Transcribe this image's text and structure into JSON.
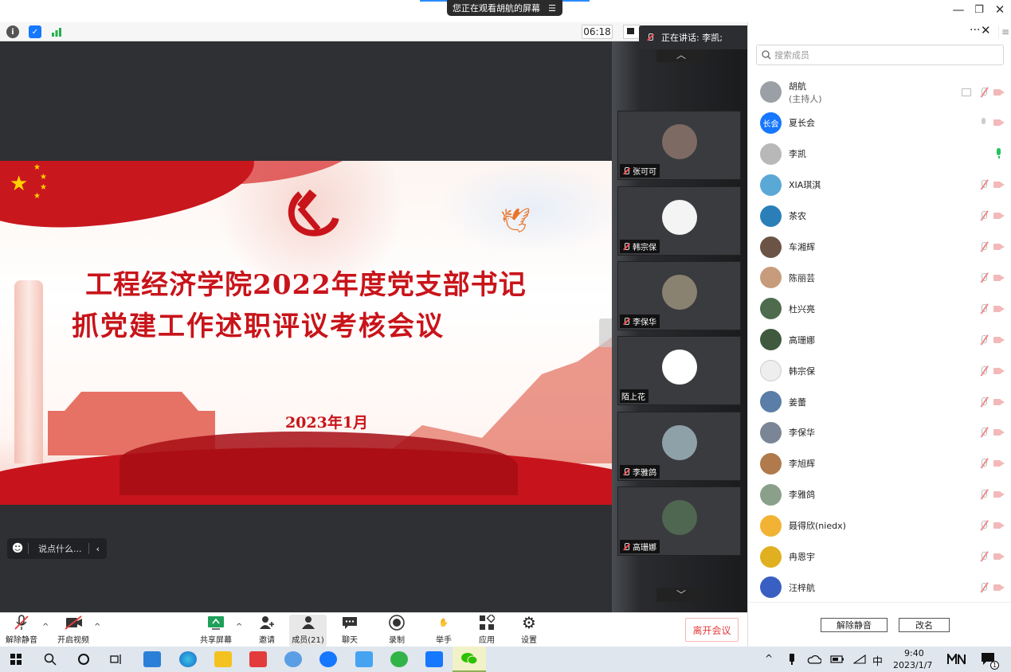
{
  "window": {
    "banner": "您正在观看胡航的屏幕",
    "banner_menu": "☰",
    "minimize": "—",
    "restore": "❐",
    "close": "✕"
  },
  "infobar": {
    "timer": "06:18"
  },
  "speaking": {
    "label": "正在讲话: 李凯;"
  },
  "slide": {
    "title_line1": "工程经济学院2022年度党支部书记",
    "title_line2": "抓党建工作述职评议考核会议",
    "date": "2023年1月"
  },
  "chat": {
    "placeholder": "说点什么..."
  },
  "tiles": [
    {
      "name": "张可可",
      "muted": true,
      "color": "#7d6b63"
    },
    {
      "name": "韩宗保",
      "muted": true,
      "color": "#f4f4f4"
    },
    {
      "name": "李保华",
      "muted": true,
      "color": "#8a8270"
    },
    {
      "name": "陌上花",
      "muted": false,
      "color": "#ffffff"
    },
    {
      "name": "李雅鸽",
      "muted": true,
      "color": "#8fa1a8"
    },
    {
      "name": "高珊娜",
      "muted": true,
      "color": "#4f6650"
    }
  ],
  "panel": {
    "more": "···",
    "close": "✕",
    "list_icon": "≡",
    "search_placeholder": "搜索成员",
    "members": [
      {
        "name": "胡航",
        "role": "(主持人)",
        "avatar_color": "#9aa0a6",
        "avatar_text": "",
        "state": "host"
      },
      {
        "name": "夏长会",
        "role": "",
        "avatar_color": "#1677ff",
        "avatar_text": "长会",
        "state": "mic-on"
      },
      {
        "name": "李凯",
        "role": "",
        "avatar_color": "#b8b8b8",
        "avatar_text": "",
        "state": "speaking"
      },
      {
        "name": "XIA琪淇",
        "role": "",
        "avatar_color": "#5aa8d6",
        "avatar_text": "",
        "state": "muted"
      },
      {
        "name": "茶农",
        "role": "",
        "avatar_color": "#2b7fb8",
        "avatar_text": "",
        "state": "muted"
      },
      {
        "name": "车湘辉",
        "role": "",
        "avatar_color": "#6b5446",
        "avatar_text": "",
        "state": "muted"
      },
      {
        "name": "陈丽芸",
        "role": "",
        "avatar_color": "#c79c7c",
        "avatar_text": "",
        "state": "muted"
      },
      {
        "name": "杜兴亮",
        "role": "",
        "avatar_color": "#4e6b4e",
        "avatar_text": "",
        "state": "muted"
      },
      {
        "name": "高珊娜",
        "role": "",
        "avatar_color": "#3f5a3f",
        "avatar_text": "",
        "state": "muted"
      },
      {
        "name": "韩宗保",
        "role": "",
        "avatar_color": "#eeeeee",
        "avatar_text": "",
        "state": "muted"
      },
      {
        "name": "姜蕾",
        "role": "",
        "avatar_color": "#5b7ea8",
        "avatar_text": "",
        "state": "muted"
      },
      {
        "name": "李保华",
        "role": "",
        "avatar_color": "#7a8596",
        "avatar_text": "",
        "state": "muted"
      },
      {
        "name": "李旭辉",
        "role": "",
        "avatar_color": "#b07a4c",
        "avatar_text": "",
        "state": "muted"
      },
      {
        "name": "李雅鸽",
        "role": "",
        "avatar_color": "#8aa08a",
        "avatar_text": "",
        "state": "muted"
      },
      {
        "name": "聂得欣(niedx)",
        "role": "",
        "avatar_color": "#f2b233",
        "avatar_text": "",
        "state": "muted"
      },
      {
        "name": "冉恩宇",
        "role": "",
        "avatar_color": "#e0b020",
        "avatar_text": "",
        "state": "muted"
      },
      {
        "name": "汪梓航",
        "role": "",
        "avatar_color": "#3a5fc2",
        "avatar_text": "",
        "state": "muted"
      }
    ],
    "unmute_all": "解除静音",
    "rename": "改名"
  },
  "toolbar": {
    "unmute": "解除静音",
    "start_video": "开启视频",
    "share": "共享屏幕",
    "invite": "邀请",
    "members": "成员(21)",
    "chat": "聊天",
    "record": "录制",
    "raise_hand": "举手",
    "apps": "应用",
    "settings": "设置",
    "leave": "离开会议",
    "caret": "^"
  },
  "taskbar": {
    "time": "9:40",
    "date": "2023/1/7",
    "ime": "中",
    "up_caret": "^",
    "notif_count": "1"
  }
}
